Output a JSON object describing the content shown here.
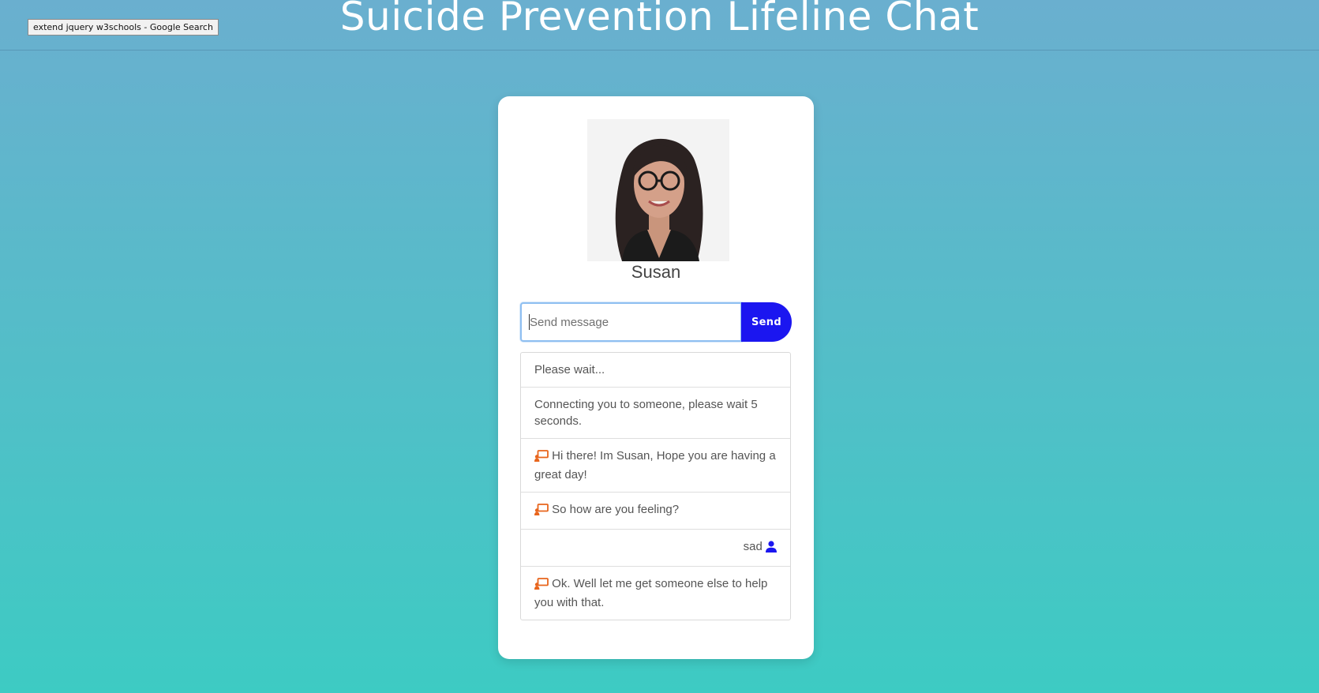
{
  "header": {
    "title": "Suicide Prevention Lifeline Chat"
  },
  "tooltip": {
    "text": "extend jquery w3schools - Google Search"
  },
  "agent": {
    "name": "Susan"
  },
  "composer": {
    "placeholder": "Send message",
    "send_label": "Send"
  },
  "messages": [
    {
      "sender": "system",
      "text": "Please wait..."
    },
    {
      "sender": "system",
      "text": "Connecting you to someone, please wait 5 seconds."
    },
    {
      "sender": "agent",
      "text": "Hi there! Im Susan, Hope you are having a great day!"
    },
    {
      "sender": "agent",
      "text": "So how are you feeling?"
    },
    {
      "sender": "user",
      "text": "sad"
    },
    {
      "sender": "agent",
      "text": "Ok. Well let me get someone else to help you with that."
    }
  ],
  "icons": {
    "agent": "chat-bubble-icon",
    "user": "user-icon"
  },
  "colors": {
    "accent": "#1b16f0",
    "agent_icon": "#e8651c",
    "user_icon": "#1b16f0",
    "background_top": "#6aafcf",
    "background_bottom": "#3dcbc3"
  }
}
